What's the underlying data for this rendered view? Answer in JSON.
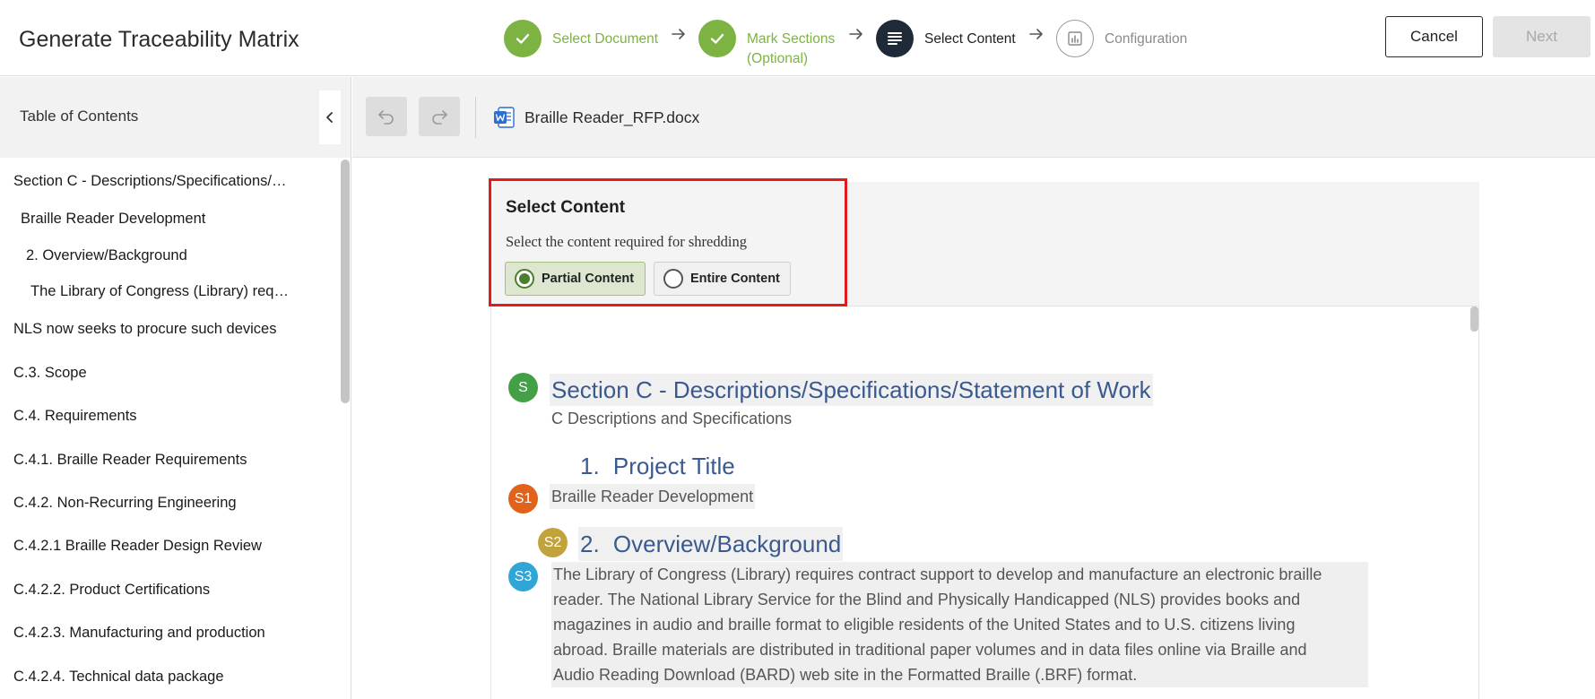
{
  "header": {
    "title": "Generate Traceability Matrix",
    "steps": [
      {
        "label": "Select Document",
        "status": "done"
      },
      {
        "label_line1": "Mark Sections",
        "label_line2": "(Optional)",
        "status": "done"
      },
      {
        "label": "Select Content",
        "status": "active"
      },
      {
        "label": "Configuration",
        "status": "pending"
      }
    ],
    "cancel_label": "Cancel",
    "next_label": "Next"
  },
  "sidebar": {
    "title": "Table of Contents",
    "items": [
      {
        "label": "Section C - Descriptions/Specifications/Statement of Work"
      },
      {
        "label": "Braille Reader Development"
      },
      {
        "label": "2. Overview/Background"
      },
      {
        "label": "The Library of Congress (Library) requires contract support"
      },
      {
        "label": "NLS now seeks to procure such devices"
      },
      {
        "label": "C.3. Scope"
      },
      {
        "label": "C.4. Requirements"
      },
      {
        "label": "C.4.1. Braille Reader Requirements"
      },
      {
        "label": "C.4.2. Non-Recurring Engineering"
      },
      {
        "label": "C.4.2.1 Braille Reader Design Review"
      },
      {
        "label": "C.4.2.2. Product Certifications"
      },
      {
        "label": "C.4.2.3. Manufacturing and production"
      },
      {
        "label": "C.4.2.4. Technical data package"
      }
    ]
  },
  "toolbar": {
    "undo_icon": "undo-icon",
    "redo_icon": "redo-icon",
    "file_name": "Braille Reader_RFP.docx",
    "file_icon": "word-doc-icon"
  },
  "select_content": {
    "title": "Select Content",
    "subtitle": "Select the content required for shredding",
    "options": [
      {
        "label": "Partial Content",
        "selected": true
      },
      {
        "label": "Entire Content",
        "selected": false
      }
    ]
  },
  "document": {
    "section_badge": "S",
    "section_heading": "Section C - Descriptions/Specifications/Statement of Work",
    "section_sub": "C Descriptions and Specifications",
    "h1_number": "1.",
    "h1_text": "Project Title",
    "s1_badge": "S1",
    "s1_text": "Braille Reader Development",
    "s2_badge": "S2",
    "h2_number": "2.",
    "h2_text": "Overview/Background",
    "s3_badge": "S3",
    "paragraph_lines": [
      "The Library of Congress (Library) requires contract support to develop and manufacture an electronic braille",
      "reader. The National Library Service for the Blind and Physically Handicapped (NLS) provides books and",
      "magazines in audio and braille format to eligible residents of the United States and to U.S. citizens living",
      "abroad. Braille materials are distributed in traditional paper volumes and in data files online via Braille and",
      "Audio Reading Download (BARD) web site in the Formatted Braille (.BRF) format."
    ]
  },
  "colors": {
    "step_done": "#7cb342",
    "step_active": "#1f2a38",
    "highlight_border": "#e21c1c",
    "badge_s": "#43a047",
    "badge_s1": "#e0621b",
    "badge_s2": "#c2a23a",
    "badge_s3": "#2fa6d6",
    "heading_blue": "#3a5a8f"
  }
}
